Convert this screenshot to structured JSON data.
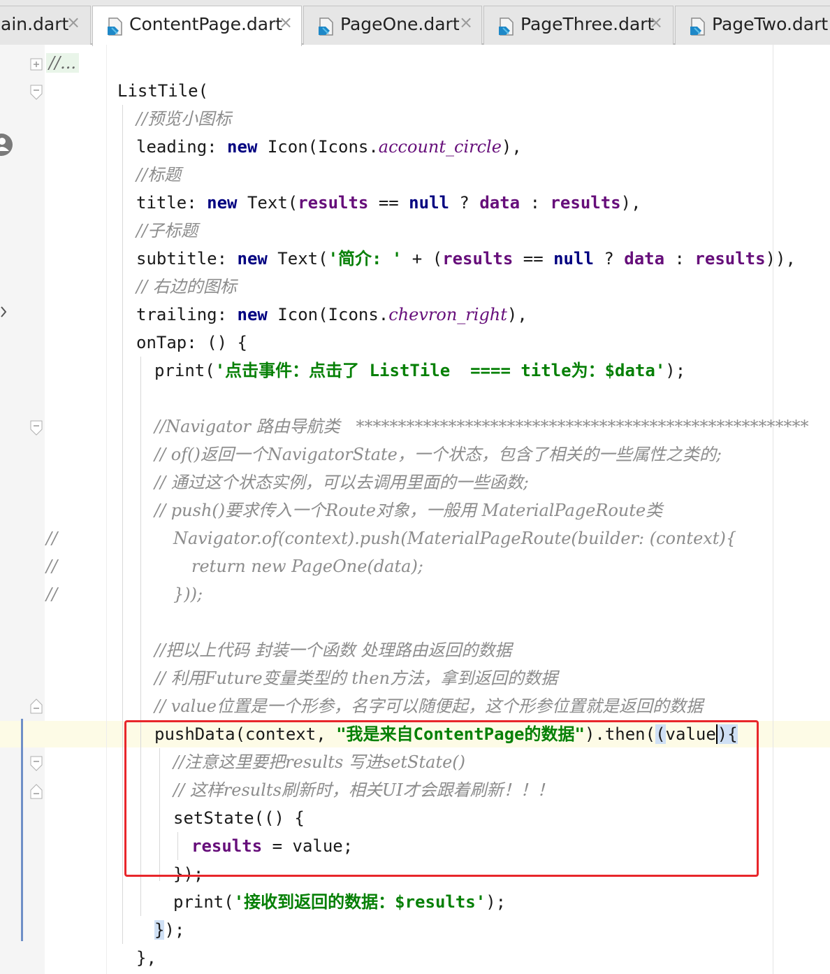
{
  "tabs": [
    {
      "label": "ain.dart"
    },
    {
      "label": "ContentPage.dart"
    },
    {
      "label": "PageOne.dart"
    },
    {
      "label": "PageThree.dart"
    },
    {
      "label": "PageTwo.dart"
    }
  ],
  "tab_close_glyph": "×",
  "code": {
    "collapsed": "//...",
    "l_listtile": "ListTile(",
    "c_preview_icon": "//预览小图标",
    "l_leading": {
      "key": "leading: ",
      "kw": "new",
      "pre": " Icon(Icons.",
      "val": "account_circle",
      "post": "),"
    },
    "c_title": "//标题",
    "l_title": {
      "key": "title: ",
      "kw": "new",
      "a": " Text(",
      "f1": "results",
      "b": " == ",
      "kw2": "null",
      "c": " ? ",
      "f2": "data",
      "d": " : ",
      "f3": "results",
      "e": "),"
    },
    "c_subtitle": "//子标题",
    "l_subtitle": {
      "key": "subtitle: ",
      "kw": "new",
      "a": " Text(",
      "s": "'简介: '",
      "b": " + (",
      "f1": "results",
      "c": " == ",
      "kw2": "null",
      "d": " ? ",
      "f2": "data",
      "e": " : ",
      "f3": "results",
      "g": ")),"
    },
    "c_trailing": "// 右边的图标",
    "l_trailing": {
      "key": "trailing: ",
      "kw": "new",
      "pre": " Icon(Icons.",
      "val": "chevron_right",
      "post": "),"
    },
    "l_ontap": "onTap: () {",
    "l_print1": {
      "a": "print(",
      "s": "'点击事件：点击了 ListTile  ==== title为：$data'",
      "b": ");"
    },
    "c_nav1": "//Navigator 路由导航类   ******************************************************",
    "c_nav2": "// of()返回一个NavigatorState，一个状态，包含了相关的一些属性之类的;",
    "c_nav3": "// 通过这个状态实例，可以去调用里面的一些函数;",
    "c_nav4": "// push()要求传入一个Route对象，一般用 MaterialPageRoute类",
    "gut_slash": "//",
    "c_nav5": "Navigator.of(context).push(MaterialPageRoute(builder: (context){",
    "c_nav6": "return new PageOne(data);",
    "c_nav7": "}));",
    "c_wrap1": "//把以上代码 封装一个函数 处理路由返回的数据",
    "c_wrap2": "// 利用Future变量类型的 then方法，拿到返回的数据",
    "c_wrap3": "// value位置是一个形参，名字可以随便起，这个形参位置就是返回的数据",
    "l_push": {
      "a": "pushData(context, ",
      "s": "\"我是来自ContentPage的数据\"",
      "b": ").then(",
      "p1": "(",
      "c": "value",
      "p2": ")",
      "p3": "{"
    },
    "c_note1": "//注意这里要把results 写进setState()",
    "c_note2": "// 这样results刷新时，相关UI才会跟着刷新！！！",
    "l_setstate": "setState(() {",
    "l_assign": {
      "f": "results",
      "b": " = value;"
    },
    "l_close_setstate": "});",
    "l_print2": {
      "a": "print(",
      "s": "'接收到返回的数据：$results'",
      "b": ");"
    },
    "l_close_then": {
      "br": "}",
      "b": ");"
    },
    "l_close_ontap": "},"
  },
  "colors": {
    "highlight_box": "#e8262b",
    "keyword": "#000080",
    "string": "#068006",
    "field": "#660e7a",
    "comment": "#8c8c8c"
  }
}
